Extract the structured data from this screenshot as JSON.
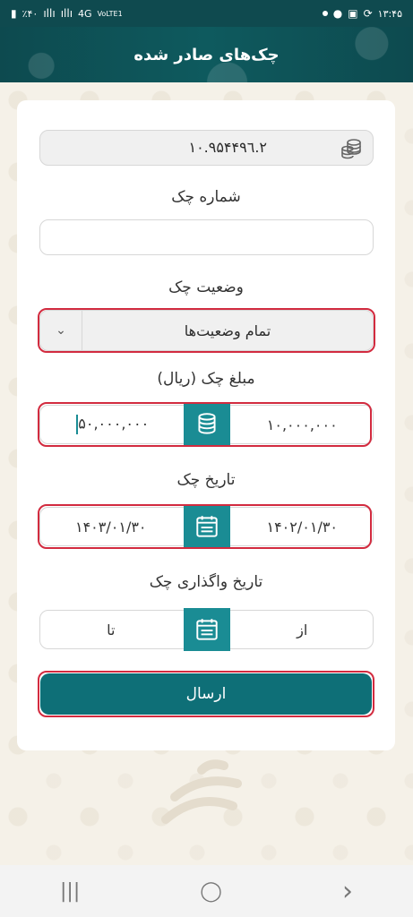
{
  "statusbar": {
    "left_text": "٪۴۰",
    "network": "4G",
    "lte": "VoLTE1",
    "time": "۱۳:۴۵"
  },
  "header": {
    "title": "چک‌های صادر شده"
  },
  "account": {
    "value": "۱۰.۹۵۴۴۹٦.۲"
  },
  "check_number": {
    "label": "شماره چک",
    "value": ""
  },
  "check_status": {
    "label": "وضعیت چک",
    "selected": "تمام وضعیت‌ها"
  },
  "amount": {
    "label": "مبلغ چک (ریال)",
    "from": "۱۰,۰۰۰,۰۰۰",
    "to": "۵۰,۰۰۰,۰۰۰"
  },
  "check_date": {
    "label": "تاریخ چک",
    "from": "۱۴۰۲/۰۱/۳۰",
    "to": "۱۴۰۳/۰۱/۳۰"
  },
  "assign_date": {
    "label": "تاریخ واگذاری چک",
    "from": "از",
    "to": "تا"
  },
  "submit": {
    "label": "ارسال"
  },
  "colors": {
    "primary": "#0e6f77",
    "accent": "#1a8c94",
    "highlight": "#d22b3f"
  },
  "navbar": {
    "recent": "|||",
    "home": "◯",
    "back": "›"
  }
}
